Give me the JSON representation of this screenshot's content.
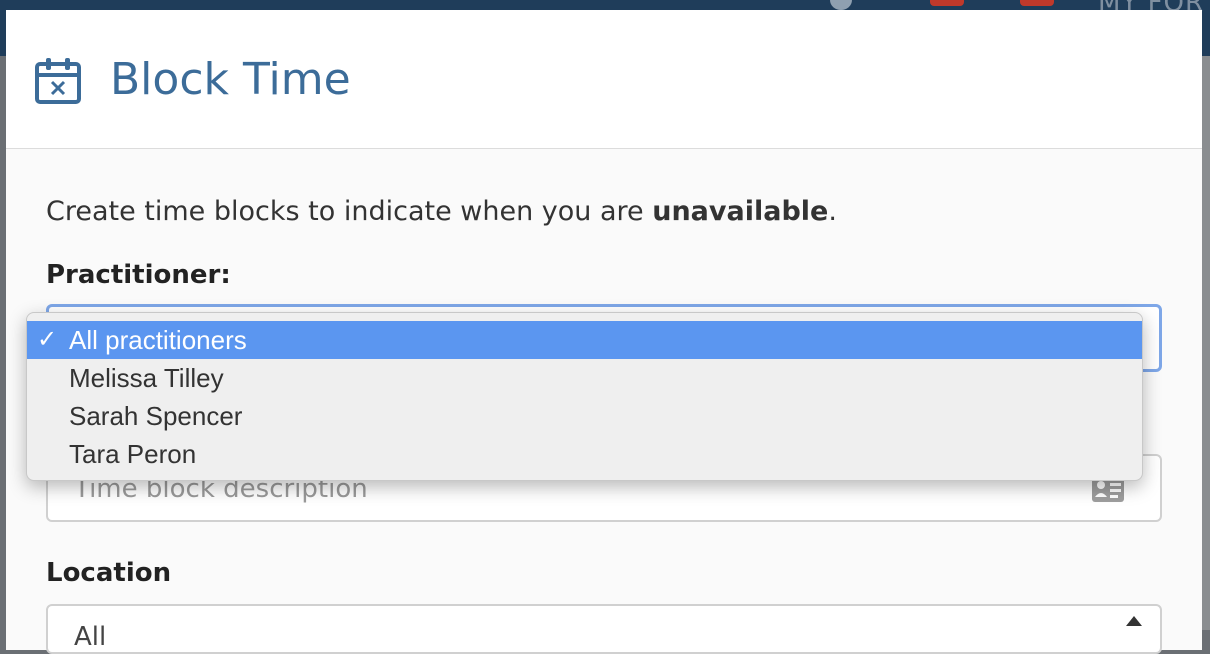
{
  "backdrop": {
    "corner_text": "MY FOR"
  },
  "modal": {
    "title": "Block Time",
    "intro_text": "Create time blocks to indicate when you are ",
    "intro_emphasis": "unavailable",
    "intro_end": ".",
    "practitioner_label": "Practitioner:",
    "description_placeholder": "Time block description",
    "location_label": "Location",
    "location_value": "All"
  },
  "dropdown": {
    "options": [
      {
        "label": "All practitioners",
        "selected": true,
        "check": "✓"
      },
      {
        "label": "Melissa Tilley",
        "selected": false
      },
      {
        "label": "Sarah Spencer",
        "selected": false
      },
      {
        "label": "Tara Peron",
        "selected": false
      }
    ]
  },
  "colors": {
    "title": "#3c6c99",
    "selected_option": "#5b96f0",
    "focus_border": "#7ea7e8"
  },
  "icons": {
    "header": "calendar-x-icon",
    "description_field": "id-card-icon",
    "location_arrow": "caret-up-icon"
  }
}
